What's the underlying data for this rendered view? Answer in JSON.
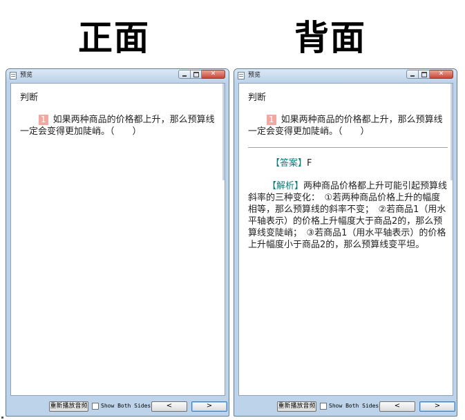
{
  "headings": {
    "front": "正面",
    "back": "背面"
  },
  "windows": {
    "front": {
      "title": "预览",
      "section": "判断",
      "question_number": "1",
      "question_text": "如果两种商品的价格都上升，那么预算线一定会变得更加陡峭。（　　）",
      "controls": {
        "replay": "重新播放音频",
        "show_both_sides": "Show Both Sides",
        "prev": "<",
        "next": ">"
      }
    },
    "back": {
      "title": "预览",
      "section": "判断",
      "question_number": "1",
      "question_text": "如果两种商品的价格都上升，那么预算线一定会变得更加陡峭。（　　）",
      "answer_tag": "【答案】",
      "answer_value": "F",
      "analysis_tag": "【解析】",
      "analysis_text": "两种商品价格都上升可能引起预算线斜率的三种变化：　①若两种商品价格上升的幅度相等，那么预算线的斜率不变；　②若商品1（用水平轴表示）的价格上升幅度大于商品2的，那么预算线变陡峭；　③若商品1（用水平轴表示）的价格上升幅度小于商品2的，那么预算线变平坦。",
      "controls": {
        "replay": "重新播放音频",
        "show_both_sides": "Show Both Sides",
        "prev": "<",
        "next": ">"
      }
    }
  },
  "colors": {
    "window_frame": "#bcd3ea",
    "question_badge": "#f2a8a0",
    "answer_tag": "#0a7d7d",
    "close_button": "#c8473a"
  }
}
